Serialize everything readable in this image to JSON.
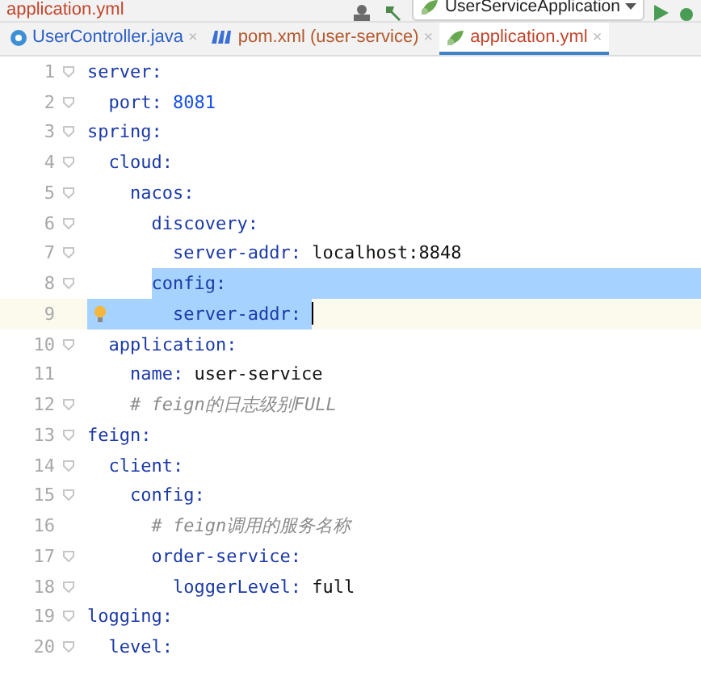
{
  "title_bar": {
    "file": "application.yml",
    "run_config": "UserServiceApplication"
  },
  "tabs": [
    {
      "label": "UserController.java",
      "kind": "class",
      "color": "#2a5ec7",
      "selected": false,
      "close": "×"
    },
    {
      "label": "pom.xml (user-service)",
      "kind": "maven",
      "color": "#b4572a",
      "selected": false,
      "close": "×"
    },
    {
      "label": "application.yml",
      "kind": "yaml",
      "color": "#c2452a",
      "selected": true,
      "close": "×"
    }
  ],
  "lines": [
    {
      "number": "1",
      "foldable": true,
      "tokens": [
        {
          "kind": "key",
          "text": "server:"
        }
      ]
    },
    {
      "number": "2",
      "foldable": true,
      "tokens": [
        {
          "kind": "key",
          "text": "  port:"
        },
        {
          "kind": "number",
          "text": " 8081"
        }
      ]
    },
    {
      "number": "3",
      "foldable": true,
      "tokens": [
        {
          "kind": "key",
          "text": "spring:"
        }
      ]
    },
    {
      "number": "4",
      "foldable": true,
      "tokens": [
        {
          "kind": "key",
          "text": "  cloud:"
        }
      ]
    },
    {
      "number": "5",
      "foldable": true,
      "tokens": [
        {
          "kind": "key",
          "text": "    nacos:"
        }
      ]
    },
    {
      "number": "6",
      "foldable": true,
      "tokens": [
        {
          "kind": "key",
          "text": "      discovery:"
        }
      ]
    },
    {
      "number": "7",
      "foldable": true,
      "tokens": [
        {
          "kind": "key",
          "text": "        server-addr:"
        },
        {
          "kind": "value",
          "text": " localhost:8848"
        }
      ]
    },
    {
      "number": "8",
      "foldable": true,
      "selected_to_end": true,
      "tokens": [
        {
          "kind": "key",
          "text": "      config:",
          "selected": true
        }
      ]
    },
    {
      "number": "9",
      "foldable": false,
      "current": true,
      "bulb": true,
      "caret": true,
      "tokens": [
        {
          "kind": "key",
          "text": "        server-addr: ",
          "selected": true
        }
      ]
    },
    {
      "number": "10",
      "foldable": true,
      "tokens": [
        {
          "kind": "key",
          "text": "  application:"
        }
      ]
    },
    {
      "number": "11",
      "foldable": false,
      "tokens": [
        {
          "kind": "key",
          "text": "    name:"
        },
        {
          "kind": "value",
          "text": " user-service"
        }
      ]
    },
    {
      "number": "12",
      "foldable": true,
      "tokens": [
        {
          "kind": "comment",
          "text": "    # feign的日志级别FULL"
        }
      ]
    },
    {
      "number": "13",
      "foldable": true,
      "tokens": [
        {
          "kind": "key",
          "text": "feign:"
        }
      ]
    },
    {
      "number": "14",
      "foldable": true,
      "tokens": [
        {
          "kind": "key",
          "text": "  client:"
        }
      ]
    },
    {
      "number": "15",
      "foldable": true,
      "tokens": [
        {
          "kind": "key",
          "text": "    config:"
        }
      ]
    },
    {
      "number": "16",
      "foldable": false,
      "tokens": [
        {
          "kind": "comment",
          "text": "      # feign调用的服务名称"
        }
      ]
    },
    {
      "number": "17",
      "foldable": true,
      "tokens": [
        {
          "kind": "key",
          "text": "      order-service:"
        }
      ]
    },
    {
      "number": "18",
      "foldable": true,
      "tokens": [
        {
          "kind": "key",
          "text": "        loggerLevel:"
        },
        {
          "kind": "value",
          "text": " full"
        }
      ]
    },
    {
      "number": "19",
      "foldable": true,
      "tokens": [
        {
          "kind": "key",
          "text": "logging:"
        }
      ]
    },
    {
      "number": "20",
      "foldable": true,
      "tokens": [
        {
          "kind": "key",
          "text": "  level:"
        }
      ]
    }
  ]
}
